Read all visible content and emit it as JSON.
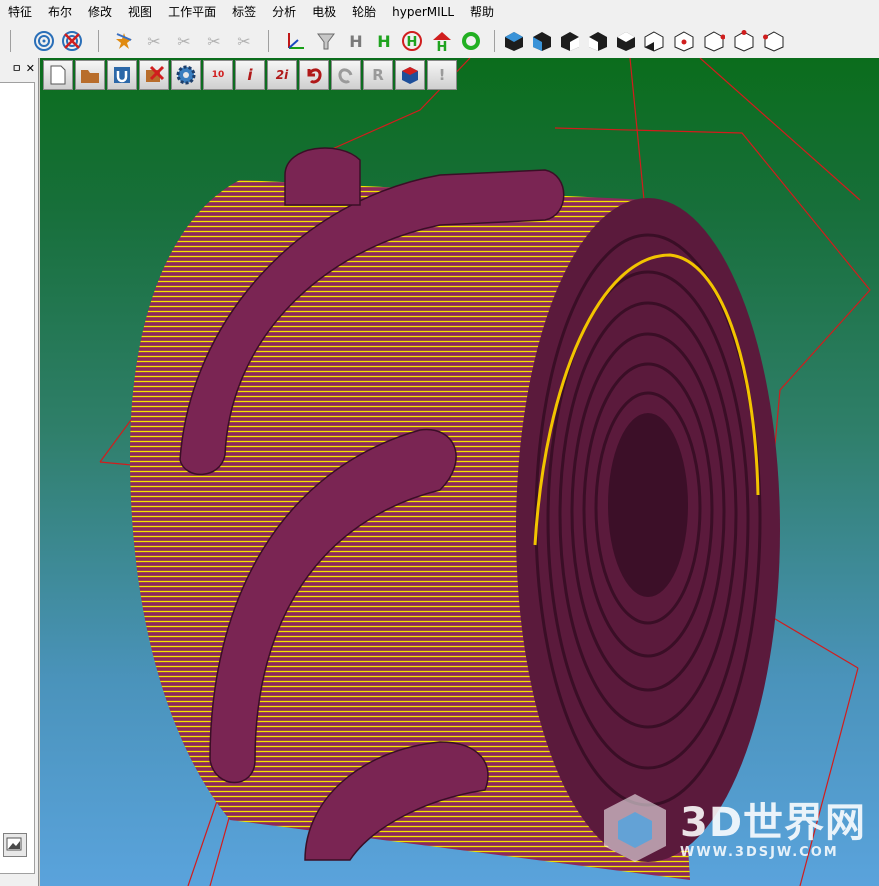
{
  "menu": {
    "items": [
      "特征",
      "布尔",
      "修改",
      "视图",
      "工作平面",
      "标签",
      "分析",
      "电极",
      "轮胎",
      "hyperMILL",
      "帮助"
    ]
  },
  "toolbar": {
    "icons": [
      "target-icon",
      "cancel-target-icon",
      "star-tool-icon",
      "milling-icon",
      "milling-icon",
      "milling-icon",
      "milling-icon",
      "axis-icon",
      "funnel-icon",
      "h-gray-icon",
      "h-green-icon",
      "h-red-circle-icon",
      "h-green-red-icon",
      "ring-green-icon",
      "cube-view-1",
      "cube-view-2",
      "cube-view-3",
      "cube-view-4",
      "cube-view-5",
      "cube-view-6",
      "cube-view-7",
      "cube-view-8",
      "cube-view-9",
      "cube-view-10"
    ]
  },
  "viewport_toolbar": {
    "icons": [
      "new-doc-icon",
      "folder-icon",
      "magnet-icon",
      "delete-icon",
      "gear-icon",
      "calc-icon",
      "info-icon",
      "2i-icon",
      "undo-icon",
      "redo-icon",
      "r-icon",
      "cube-red-icon",
      "warning-icon"
    ],
    "labels": [
      "",
      "",
      "",
      "",
      "",
      "10",
      "i",
      "2i",
      "",
      "",
      "R",
      "",
      "!"
    ]
  },
  "panel": {
    "pin_label": "ㅁ",
    "close_label": "✕"
  },
  "watermark": {
    "text": "3D世界网",
    "url": "WWW.3DSJW.COM"
  },
  "colors": {
    "part": "#7a2553",
    "toolpath": "#f2e400",
    "bg_top": "#0b6d1c",
    "bg_bottom": "#5aa3dc",
    "stock_line": "#d21c1c"
  }
}
